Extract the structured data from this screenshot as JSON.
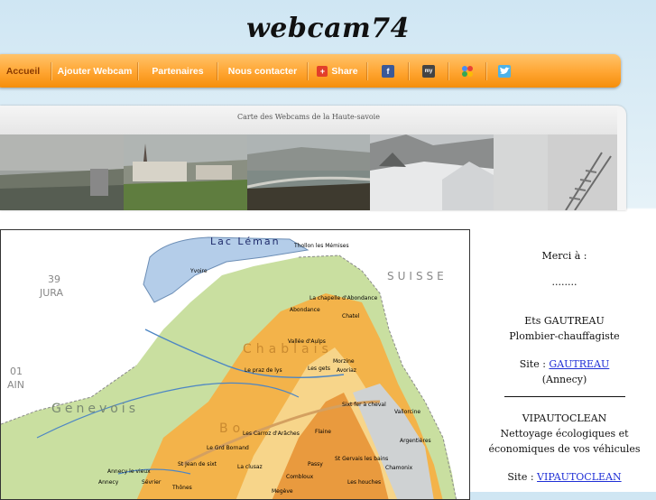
{
  "site": {
    "title": "webcam74"
  },
  "nav": {
    "items": [
      {
        "label": "Accueil"
      },
      {
        "label": "Ajouter Webcam"
      },
      {
        "label": "Partenaires"
      },
      {
        "label": "Nous contacter"
      },
      {
        "label": "Share"
      }
    ],
    "social_icons": [
      "facebook-icon",
      "myspace-icon",
      "google-icon",
      "twitter-icon"
    ]
  },
  "banner": {
    "caption": "Carte des Webcams de la Haute-savoie",
    "webcams": [
      "webcam-1",
      "webcam-2",
      "webcam-3",
      "webcam-4",
      "webcam-5"
    ]
  },
  "map": {
    "regions": {
      "lac_leman": "Lac Léman",
      "suisse": "SUISSE",
      "jura_num": "39",
      "jura": "JURA",
      "ain_num": "01",
      "ain": "AIN",
      "genevois": "Genevois",
      "chablais": "Chablais",
      "bornes": "Bo"
    },
    "places": [
      "Thollon les Mémises",
      "Yvoire",
      "La chapelle d'Abondance",
      "Abondance",
      "Chatel",
      "Vallée d'Aulps",
      "Morzine",
      "Le praz de lys",
      "Les gets",
      "Avoriaz",
      "Sixt fer à cheval",
      "Vallorcine",
      "Flaine",
      "Les Carroz d'Arâches",
      "Le Grd Bornand",
      "Argentières",
      "St Jean de sixt",
      "La clusaz",
      "Passy",
      "St Gervais les bains",
      "Chamonix",
      "Annecy le vieux",
      "Annecy",
      "Sévrier",
      "Thônes",
      "Combloux",
      "Megève",
      "Les houches"
    ]
  },
  "sidebar": {
    "thanks": "Merci à :",
    "dots": "........",
    "sponsors": [
      {
        "name": "Ets GAUTREAU",
        "desc": "Plombier-chauffagiste",
        "site_prefix": "Site : ",
        "link": "GAUTREAU",
        "city": "(Annecy)"
      },
      {
        "name": "VIPAUTOCLEAN",
        "desc": "Nettoyage écologiques et économiques de vos véhicules",
        "site_prefix": "Site : ",
        "link": "VIPAUTOCLEAN"
      }
    ]
  },
  "colors": {
    "nav_orange": "#ffa531",
    "active_nav_text": "#8a3a00",
    "link_blue": "#1f2fd6",
    "lake_blue": "#b4cde9",
    "map_green": "#c9dfa0",
    "map_orange": "#f3b34a"
  }
}
